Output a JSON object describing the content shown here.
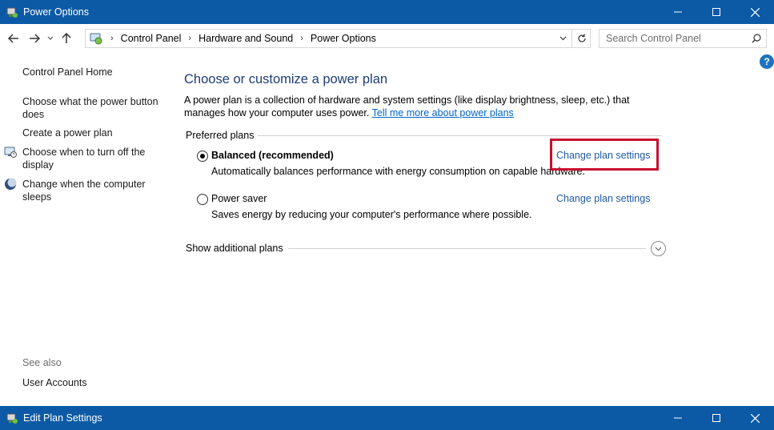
{
  "window": {
    "title": "Power Options",
    "second_window_title": "Edit Plan Settings"
  },
  "titlebar_buttons": {
    "minimize": "—",
    "maximize": "☐",
    "close": "✕"
  },
  "address": {
    "crumbs": [
      "Control Panel",
      "Hardware and Sound",
      "Power Options"
    ]
  },
  "search": {
    "placeholder": "Search Control Panel"
  },
  "help": {
    "label": "?"
  },
  "sidebar": {
    "home": "Control Panel Home",
    "items": [
      {
        "label": "Choose what the power button does",
        "icon": ""
      },
      {
        "label": "Create a power plan",
        "icon": ""
      },
      {
        "label": "Choose when to turn off the display",
        "icon": "display-power-icon"
      },
      {
        "label": "Change when the computer sleeps",
        "icon": "moon-sleep-icon"
      }
    ],
    "see_also_title": "See also",
    "see_also_items": [
      "User Accounts"
    ]
  },
  "main": {
    "heading": "Choose or customize a power plan",
    "description": "A power plan is a collection of hardware and system settings (like display brightness, sleep, etc.) that manages how your computer uses power.",
    "learn_more": "Tell me more about power plans",
    "preferred_plans_label": "Preferred plans",
    "plans": [
      {
        "name": "Balanced (recommended)",
        "description": "Automatically balances performance with energy consumption on capable hardware.",
        "selected": true,
        "link": "Change plan settings"
      },
      {
        "name": "Power saver",
        "description": "Saves energy by reducing your computer's performance where possible.",
        "selected": false,
        "link": "Change plan settings"
      }
    ],
    "show_additional": "Show additional plans"
  },
  "colors": {
    "titlebar": "#0c5aa6",
    "heading": "#1e3c78",
    "link": "#1e5aa8",
    "highlight_box": "#c8102e"
  }
}
